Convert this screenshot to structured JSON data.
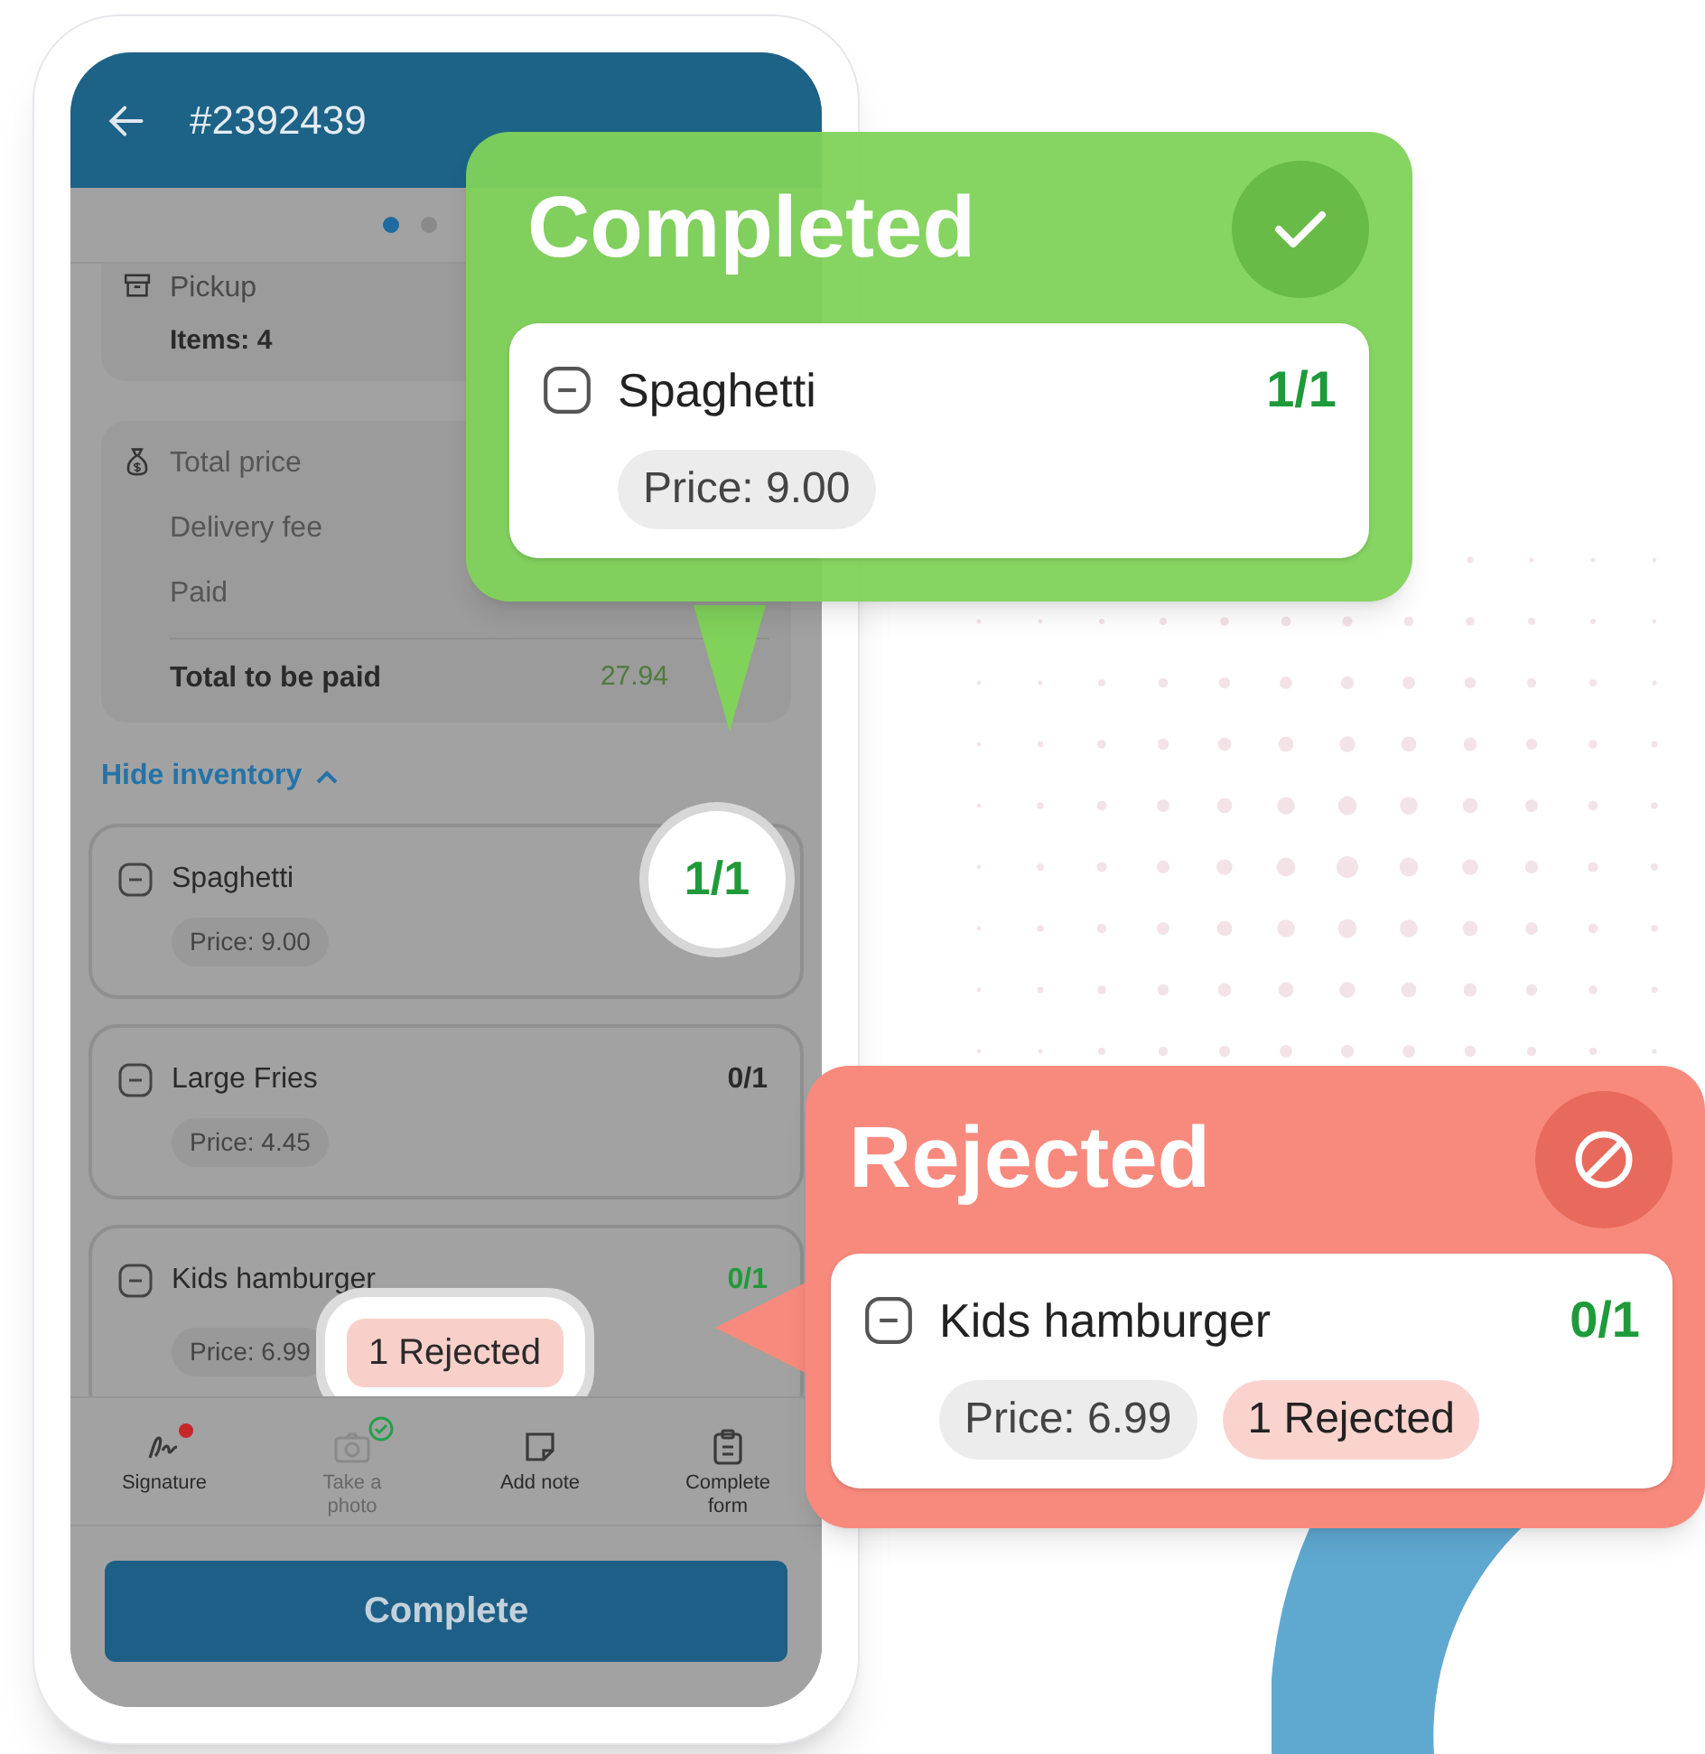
{
  "header": {
    "order_number": "#2392439"
  },
  "pager": [
    {
      "selected": true
    },
    {
      "selected": false
    }
  ],
  "pickup": {
    "label": "Pickup",
    "items": "Items: 4"
  },
  "price_summary": {
    "rows": [
      {
        "label": "Total price"
      },
      {
        "label": "Delivery fee"
      },
      {
        "label": "Paid"
      }
    ],
    "total": {
      "label": "Total to be paid",
      "value": "27.94"
    }
  },
  "inventory_toggle": "Hide inventory",
  "items": [
    {
      "name": "Spaghetti",
      "price": "Price: 9.00",
      "count": "1/1",
      "processed": true,
      "count_highlighted": true
    },
    {
      "name": "Large Fries",
      "price": "Price: 4.45",
      "count": "0/1",
      "processed": false,
      "count_highlighted": false
    },
    {
      "name": "Kids hamburger",
      "price": "Price: 6.99",
      "count": "0/1",
      "processed": true,
      "count_highlighted": false,
      "rejected": "1 Rejected",
      "rejected_highlighted": true
    }
  ],
  "actions": [
    {
      "label": "Signature",
      "kind": "signature",
      "disabled": false,
      "alert": true,
      "done": false
    },
    {
      "label": "Take a photo",
      "kind": "camera",
      "disabled": true,
      "alert": false,
      "done": true
    },
    {
      "label": "Add note",
      "kind": "note",
      "disabled": false,
      "alert": false,
      "done": false
    },
    {
      "label": "Complete form",
      "kind": "form",
      "disabled": false,
      "alert": false,
      "done": false
    }
  ],
  "complete_button": "Complete",
  "callouts": [
    {
      "kind": "completed",
      "title": "Completed",
      "item": {
        "name": "Spaghetti",
        "count": "1/1",
        "price": "Price: 9.00"
      }
    },
    {
      "kind": "rejected",
      "title": "Rejected",
      "item": {
        "name": "Kids hamburger",
        "count": "0/1",
        "price": "Price: 6.99",
        "rejected": "1 Rejected"
      }
    }
  ]
}
